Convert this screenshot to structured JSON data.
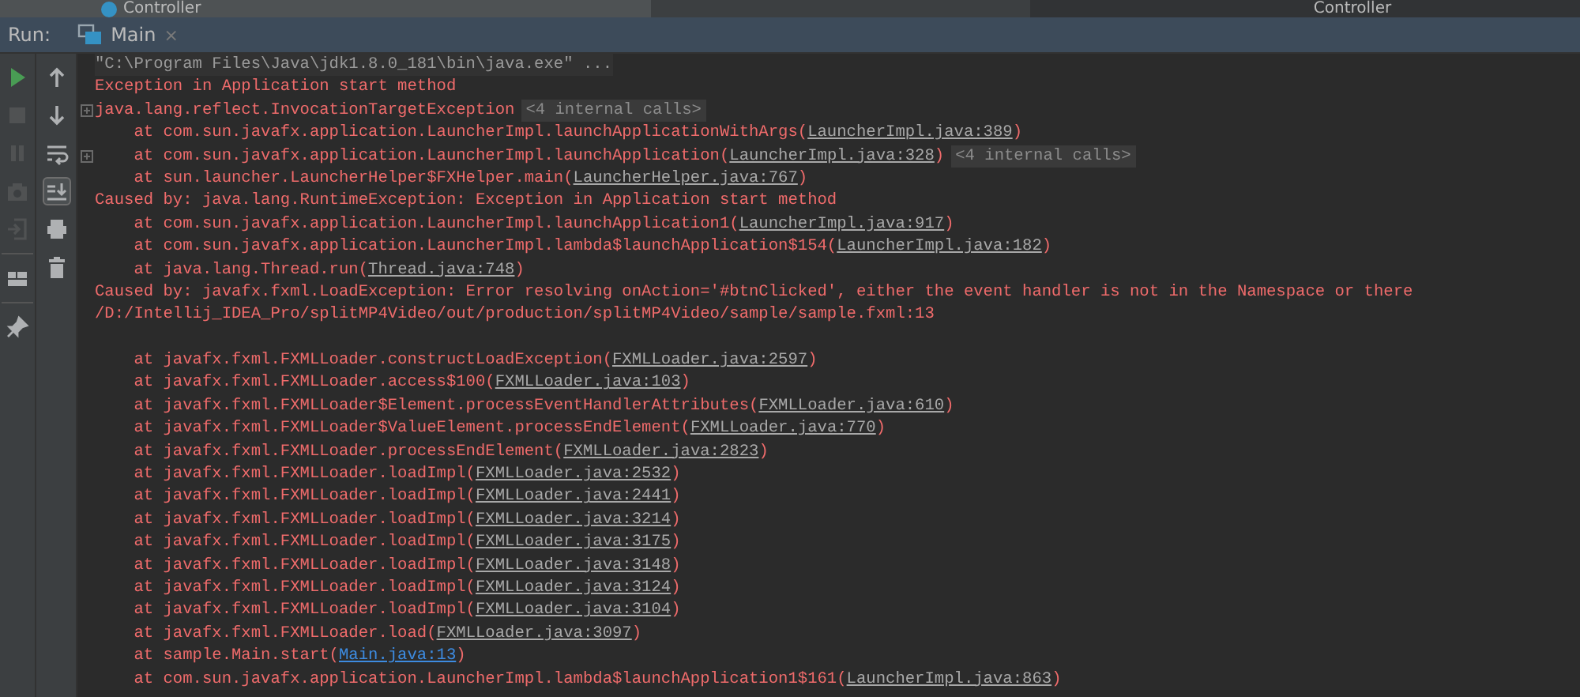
{
  "editor_tabs": [
    {
      "label": "Controller"
    },
    {
      "label": "Controller"
    }
  ],
  "run_bar": {
    "label": "Run:",
    "tabs": [
      {
        "label": "Main",
        "selected": true,
        "close": "×"
      }
    ]
  },
  "left_toolbar": [
    {
      "kind": "run",
      "disabled": false
    },
    {
      "kind": "stop",
      "disabled": true
    },
    {
      "kind": "pause",
      "disabled": true
    },
    {
      "kind": "camera",
      "disabled": true
    },
    {
      "kind": "exit",
      "disabled": true
    },
    {
      "kind": "layout",
      "disabled": false
    },
    {
      "kind": "pin",
      "disabled": false
    }
  ],
  "right_toolbar": [
    {
      "kind": "up",
      "on": false
    },
    {
      "kind": "down",
      "on": false
    },
    {
      "kind": "wrap",
      "on": false
    },
    {
      "kind": "scroll_end",
      "on": true
    },
    {
      "kind": "print",
      "on": false
    },
    {
      "kind": "trash",
      "on": false
    }
  ],
  "console": [
    {
      "segments": [
        {
          "kind": "command",
          "text": "\"C:\\Program Files\\Java\\jdk1.8.0_181\\bin\\java.exe\" ..."
        }
      ]
    },
    {
      "segments": [
        {
          "kind": "error",
          "text": "Exception in Application start method"
        }
      ]
    },
    {
      "foldable": true,
      "segments": [
        {
          "kind": "error",
          "text": "java.lang.reflect.InvocationTargetException"
        },
        {
          "kind": "folded",
          "text": "<4 internal calls>"
        }
      ]
    },
    {
      "segments": [
        {
          "kind": "error",
          "text": "    at com.sun.javafx.application.LauncherImpl.launchApplicationWithArgs("
        },
        {
          "kind": "link",
          "text": "LauncherImpl.java:389"
        },
        {
          "kind": "error",
          "text": ")"
        }
      ]
    },
    {
      "foldable": true,
      "segments": [
        {
          "kind": "error",
          "text": "    at com.sun.javafx.application.LauncherImpl.launchApplication("
        },
        {
          "kind": "link",
          "text": "LauncherImpl.java:328"
        },
        {
          "kind": "error",
          "text": ")"
        },
        {
          "kind": "folded",
          "text": "<4 internal calls>"
        }
      ]
    },
    {
      "segments": [
        {
          "kind": "error",
          "text": "    at sun.launcher.LauncherHelper$FXHelper.main("
        },
        {
          "kind": "link",
          "text": "LauncherHelper.java:767"
        },
        {
          "kind": "error",
          "text": ")"
        }
      ]
    },
    {
      "segments": [
        {
          "kind": "error",
          "text": "Caused by: java.lang.RuntimeException: Exception in Application start method"
        }
      ]
    },
    {
      "segments": [
        {
          "kind": "error",
          "text": "    at com.sun.javafx.application.LauncherImpl.launchApplication1("
        },
        {
          "kind": "link",
          "text": "LauncherImpl.java:917"
        },
        {
          "kind": "error",
          "text": ")"
        }
      ]
    },
    {
      "segments": [
        {
          "kind": "error",
          "text": "    at com.sun.javafx.application.LauncherImpl.lambda$launchApplication$154("
        },
        {
          "kind": "link",
          "text": "LauncherImpl.java:182"
        },
        {
          "kind": "error",
          "text": ")"
        }
      ]
    },
    {
      "segments": [
        {
          "kind": "error",
          "text": "    at java.lang.Thread.run("
        },
        {
          "kind": "link",
          "text": "Thread.java:748"
        },
        {
          "kind": "error",
          "text": ")"
        }
      ]
    },
    {
      "segments": [
        {
          "kind": "error",
          "text": "Caused by: javafx.fxml.LoadException: Error resolving onAction='#btnClicked', either the event handler is not in the Namespace or there"
        }
      ]
    },
    {
      "segments": [
        {
          "kind": "error",
          "text": "/D:/Intellij_IDEA_Pro/splitMP4Video/out/production/splitMP4Video/sample/sample.fxml:13"
        }
      ]
    },
    {
      "kind": "blank"
    },
    {
      "segments": [
        {
          "kind": "error",
          "text": "    at javafx.fxml.FXMLLoader.constructLoadException("
        },
        {
          "kind": "link",
          "text": "FXMLLoader.java:2597"
        },
        {
          "kind": "error",
          "text": ")"
        }
      ]
    },
    {
      "segments": [
        {
          "kind": "error",
          "text": "    at javafx.fxml.FXMLLoader.access$100("
        },
        {
          "kind": "link",
          "text": "FXMLLoader.java:103"
        },
        {
          "kind": "error",
          "text": ")"
        }
      ]
    },
    {
      "segments": [
        {
          "kind": "error",
          "text": "    at javafx.fxml.FXMLLoader$Element.processEventHandlerAttributes("
        },
        {
          "kind": "link",
          "text": "FXMLLoader.java:610"
        },
        {
          "kind": "error",
          "text": ")"
        }
      ]
    },
    {
      "segments": [
        {
          "kind": "error",
          "text": "    at javafx.fxml.FXMLLoader$ValueElement.processEndElement("
        },
        {
          "kind": "link",
          "text": "FXMLLoader.java:770"
        },
        {
          "kind": "error",
          "text": ")"
        }
      ]
    },
    {
      "segments": [
        {
          "kind": "error",
          "text": "    at javafx.fxml.FXMLLoader.processEndElement("
        },
        {
          "kind": "link",
          "text": "FXMLLoader.java:2823"
        },
        {
          "kind": "error",
          "text": ")"
        }
      ]
    },
    {
      "segments": [
        {
          "kind": "error",
          "text": "    at javafx.fxml.FXMLLoader.loadImpl("
        },
        {
          "kind": "link",
          "text": "FXMLLoader.java:2532"
        },
        {
          "kind": "error",
          "text": ")"
        }
      ]
    },
    {
      "segments": [
        {
          "kind": "error",
          "text": "    at javafx.fxml.FXMLLoader.loadImpl("
        },
        {
          "kind": "link",
          "text": "FXMLLoader.java:2441"
        },
        {
          "kind": "error",
          "text": ")"
        }
      ]
    },
    {
      "segments": [
        {
          "kind": "error",
          "text": "    at javafx.fxml.FXMLLoader.loadImpl("
        },
        {
          "kind": "link",
          "text": "FXMLLoader.java:3214"
        },
        {
          "kind": "error",
          "text": ")"
        }
      ]
    },
    {
      "segments": [
        {
          "kind": "error",
          "text": "    at javafx.fxml.FXMLLoader.loadImpl("
        },
        {
          "kind": "link",
          "text": "FXMLLoader.java:3175"
        },
        {
          "kind": "error",
          "text": ")"
        }
      ]
    },
    {
      "segments": [
        {
          "kind": "error",
          "text": "    at javafx.fxml.FXMLLoader.loadImpl("
        },
        {
          "kind": "link",
          "text": "FXMLLoader.java:3148"
        },
        {
          "kind": "error",
          "text": ")"
        }
      ]
    },
    {
      "segments": [
        {
          "kind": "error",
          "text": "    at javafx.fxml.FXMLLoader.loadImpl("
        },
        {
          "kind": "link",
          "text": "FXMLLoader.java:3124"
        },
        {
          "kind": "error",
          "text": ")"
        }
      ]
    },
    {
      "segments": [
        {
          "kind": "error",
          "text": "    at javafx.fxml.FXMLLoader.loadImpl("
        },
        {
          "kind": "link",
          "text": "FXMLLoader.java:3104"
        },
        {
          "kind": "error",
          "text": ")"
        }
      ]
    },
    {
      "segments": [
        {
          "kind": "error",
          "text": "    at javafx.fxml.FXMLLoader.load("
        },
        {
          "kind": "link",
          "text": "FXMLLoader.java:3097"
        },
        {
          "kind": "error",
          "text": ")"
        }
      ]
    },
    {
      "segments": [
        {
          "kind": "error",
          "text": "    at sample.Main.start("
        },
        {
          "kind": "project_link",
          "text": "Main.java:13"
        },
        {
          "kind": "error",
          "text": ")"
        }
      ]
    },
    {
      "segments": [
        {
          "kind": "error",
          "text": "    at com.sun.javafx.application.LauncherImpl.lambda$launchApplication1$161("
        },
        {
          "kind": "link",
          "text": "LauncherImpl.java:863"
        },
        {
          "kind": "error",
          "text": ")"
        }
      ]
    }
  ]
}
